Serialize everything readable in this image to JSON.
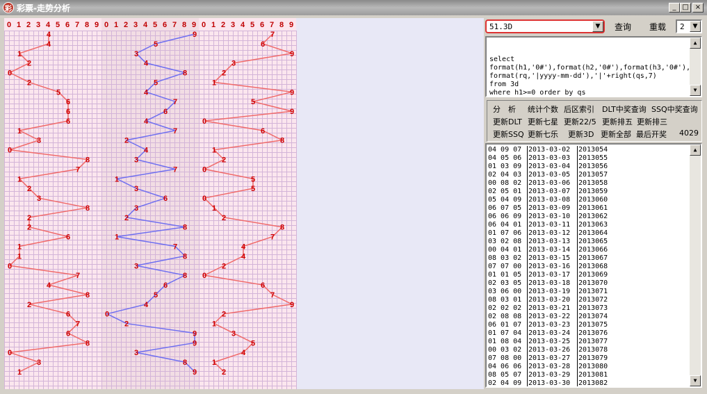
{
  "window": {
    "title": "彩票-走势分析",
    "icon": "lottery-app-icon",
    "min": "_",
    "max": "□",
    "close": "×"
  },
  "chart_data": {
    "type": "line",
    "digits": [
      "0",
      "1",
      "2",
      "3",
      "4",
      "5",
      "6",
      "7",
      "8",
      "9"
    ],
    "series": [
      {
        "color": "#f06a6a",
        "values": [
          4,
          4,
          1,
          2,
          0,
          2,
          5,
          6,
          6,
          6,
          1,
          3,
          0,
          8,
          7,
          1,
          2,
          3,
          8,
          2,
          2,
          6,
          1,
          1,
          0,
          7,
          4,
          8,
          2,
          6,
          7,
          6,
          8,
          0,
          3,
          1
        ]
      },
      {
        "color": "#6f6ff0",
        "values": [
          9,
          5,
          3,
          4,
          8,
          5,
          4,
          7,
          6,
          4,
          7,
          2,
          4,
          3,
          7,
          1,
          3,
          6,
          3,
          2,
          8,
          1,
          7,
          8,
          3,
          8,
          6,
          5,
          4,
          0,
          2,
          9,
          9,
          3,
          8,
          9
        ]
      },
      {
        "color": "#f06a6a",
        "values": [
          7,
          6,
          9,
          3,
          2,
          1,
          9,
          5,
          9,
          0,
          6,
          8,
          1,
          2,
          0,
          5,
          5,
          0,
          1,
          2,
          8,
          7,
          4,
          4,
          2,
          0,
          6,
          7,
          9,
          2,
          1,
          3,
          5,
          4,
          1,
          2
        ]
      }
    ]
  },
  "query": {
    "combo_value": "51.3D",
    "search_label": "查询",
    "reload_label": "重载",
    "reload_value": "2"
  },
  "sql_lines": [
    "select",
    "format(h1,'0#'),format(h2,'0#'),format(h3,'0#'),",
    "format(rq,'|yyyy-mm-dd'),'|'+right(qs,7)",
    "from 3d",
    "where h1>=0 order by qs"
  ],
  "buttons": {
    "analyze": "分　析",
    "count": "统计个数",
    "rear_index": "后区索引",
    "dlt_query": "DLT中奖查询",
    "ssq_query": "SSQ中奖查询",
    "update_dlt": "更新DLT",
    "update_qixing": "更新七星",
    "update_225": "更新22/5",
    "update_pl5": "更新排五",
    "update_pl3": "更新排三",
    "update_ssq": "更新SSQ",
    "update_qile": "更新七乐",
    "update_3d": "更新3D",
    "update_all": "更新全部",
    "last_draw": "最后开奖",
    "count_value": "4029"
  },
  "rows": [
    [
      "04 09 07",
      "2013-03-02",
      "2013054"
    ],
    [
      "04 05 06",
      "2013-03-03",
      "2013055"
    ],
    [
      "01 03 09",
      "2013-03-04",
      "2013056"
    ],
    [
      "02 04 03",
      "2013-03-05",
      "2013057"
    ],
    [
      "00 08 02",
      "2013-03-06",
      "2013058"
    ],
    [
      "02 05 01",
      "2013-03-07",
      "2013059"
    ],
    [
      "05 04 09",
      "2013-03-08",
      "2013060"
    ],
    [
      "06 07 05",
      "2013-03-09",
      "2013061"
    ],
    [
      "06 06 09",
      "2013-03-10",
      "2013062"
    ],
    [
      "06 04 01",
      "2013-03-11",
      "2013063"
    ],
    [
      "01 07 06",
      "2013-03-12",
      "2013064"
    ],
    [
      "03 02 08",
      "2013-03-13",
      "2013065"
    ],
    [
      "00 04 01",
      "2013-03-14",
      "2013066"
    ],
    [
      "08 03 02",
      "2013-03-15",
      "2013067"
    ],
    [
      "07 07 00",
      "2013-03-16",
      "2013068"
    ],
    [
      "01 01 05",
      "2013-03-17",
      "2013069"
    ],
    [
      "02 03 05",
      "2013-03-18",
      "2013070"
    ],
    [
      "03 06 00",
      "2013-03-19",
      "2013071"
    ],
    [
      "08 03 01",
      "2013-03-20",
      "2013072"
    ],
    [
      "02 02 02",
      "2013-03-21",
      "2013073"
    ],
    [
      "02 08 08",
      "2013-03-22",
      "2013074"
    ],
    [
      "06 01 07",
      "2013-03-23",
      "2013075"
    ],
    [
      "01 07 04",
      "2013-03-24",
      "2013076"
    ],
    [
      "01 08 04",
      "2013-03-25",
      "2013077"
    ],
    [
      "00 03 02",
      "2013-03-26",
      "2013078"
    ],
    [
      "07 08 00",
      "2013-03-27",
      "2013079"
    ],
    [
      "04 06 06",
      "2013-03-28",
      "2013080"
    ],
    [
      "08 05 07",
      "2013-03-29",
      "2013081"
    ],
    [
      "02 04 09",
      "2013-03-30",
      "2013082"
    ]
  ]
}
